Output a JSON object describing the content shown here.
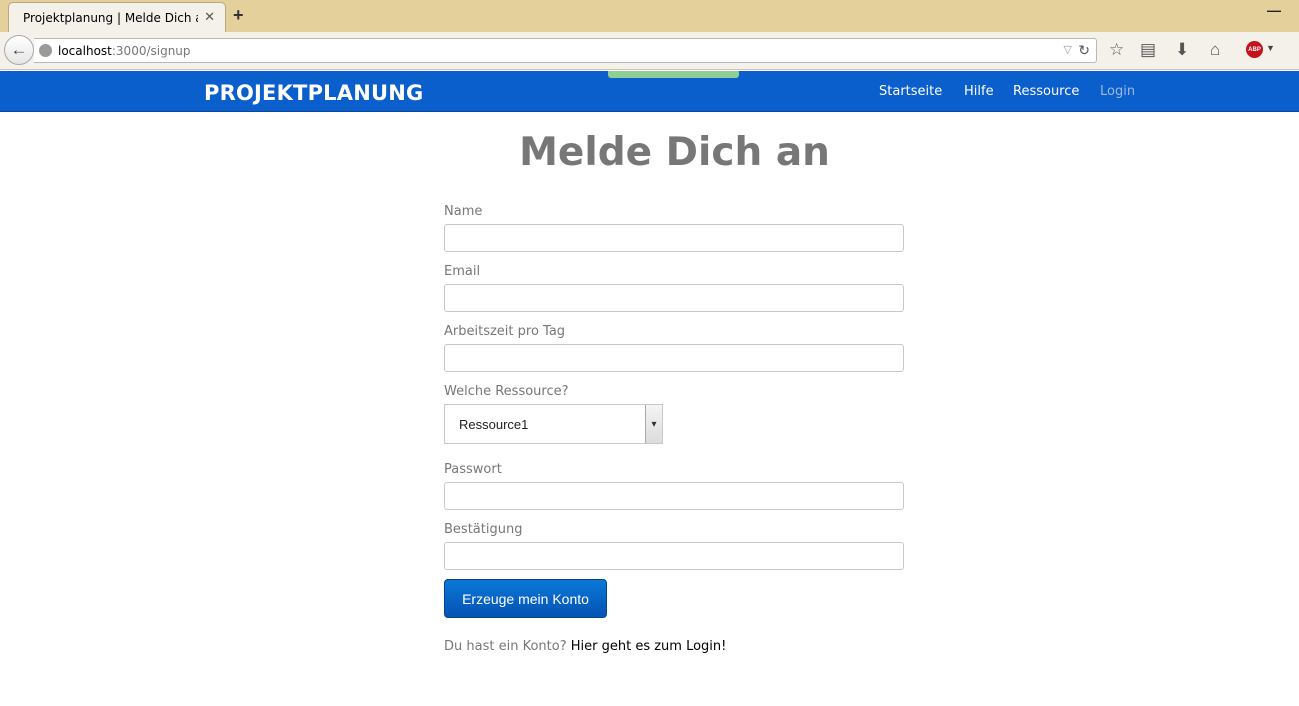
{
  "browser": {
    "tab_title": "Projektplanung | Melde Dich an",
    "tab_close": "✕",
    "new_tab": "+",
    "url_host": "localhost",
    "url_path": ":3000/signup",
    "icons": [
      "back-arrow-icon",
      "globe-icon",
      "bookmark-star-icon",
      "reading-list-icon",
      "download-icon",
      "home-icon",
      "adblock-icon"
    ]
  },
  "site": {
    "logo": "PROJEKTPLANUNG",
    "nav": [
      {
        "label": "Startseite"
      },
      {
        "label": "Hilfe"
      },
      {
        "label": "Ressource"
      },
      {
        "label": "Login"
      }
    ]
  },
  "form": {
    "heading": "Melde Dich an",
    "name_label": "Name",
    "email_label": "Email",
    "hours_label": "Arbeitszeit pro Tag",
    "resource_label": "Welche Ressource?",
    "resource_selected": "Ressource1",
    "password_label": "Passwort",
    "confirm_label": "Bestätigung",
    "submit_label": "Erzeuge mein Konto",
    "footer_text": "Du hast ein Konto?",
    "footer_link": "Hier geht es zum Login!"
  },
  "colors": {
    "nav_bg": "#0b5fcc",
    "button_bg": "#0663c2",
    "heading": "#777777"
  }
}
